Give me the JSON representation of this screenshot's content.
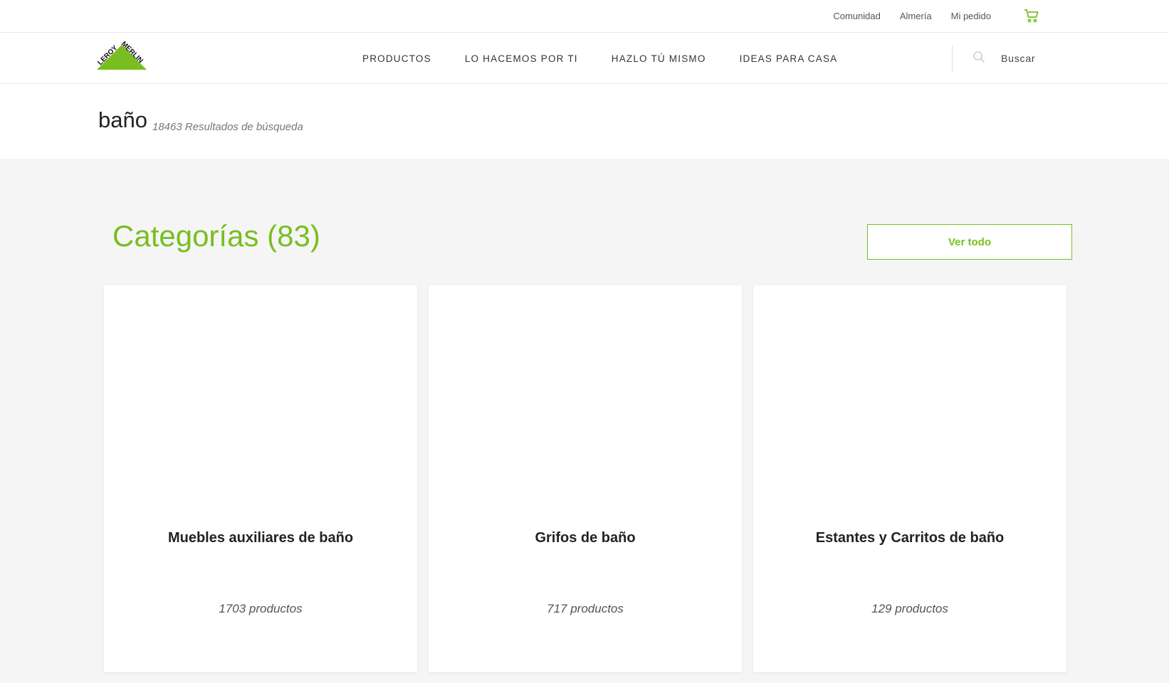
{
  "topbar": {
    "links": [
      "Comunidad",
      "Almería",
      "Mi pedido"
    ],
    "cart_icon": "cart-icon"
  },
  "header": {
    "logo_text_1": "LEROY",
    "logo_text_2": "MERLIN",
    "nav": [
      "PRODUCTOS",
      "LO HACEMOS POR TI",
      "HAZLO TÚ MISMO",
      "IDEAS PARA CASA"
    ],
    "search_label": "Buscar",
    "search_icon": "search-icon"
  },
  "search": {
    "term": "baño",
    "results": "18463 Resultados de búsqueda"
  },
  "categories": {
    "title": "Categorías (83)",
    "view_all": "Ver todo",
    "items": [
      {
        "name": "Muebles auxiliares de baño",
        "count": "1703 productos"
      },
      {
        "name": "Grifos de baño",
        "count": "717 productos"
      },
      {
        "name": "Estantes y Carritos de baño",
        "count": "129 productos"
      }
    ]
  },
  "colors": {
    "brand_green": "#78be20",
    "background_grey": "#f5f5f5"
  }
}
